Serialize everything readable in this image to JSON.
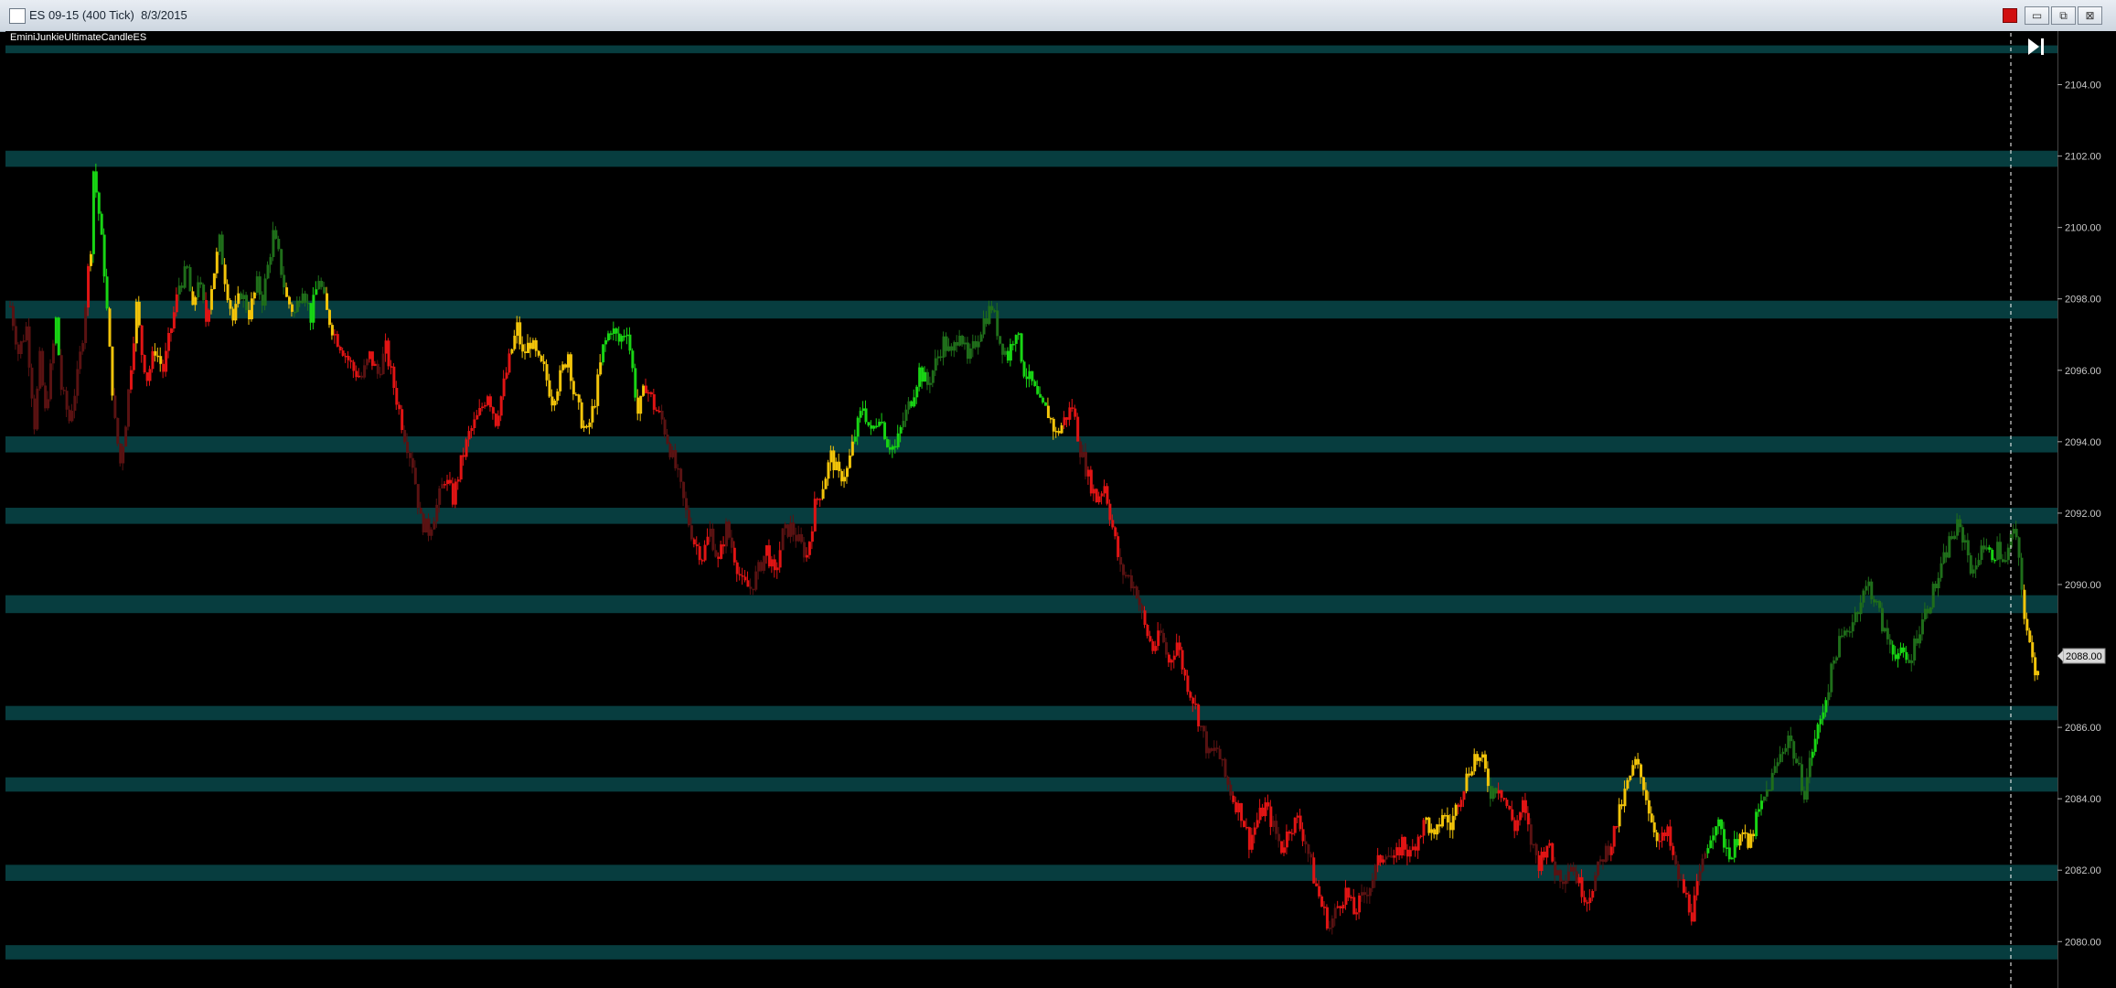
{
  "window": {
    "title": "ES 09-15 (400 Tick)  8/3/2015",
    "buttons": {
      "minimize": "▭",
      "restore": "⧉",
      "close": "⊠"
    }
  },
  "indicator_label": "EminiJunkieUltimateCandleES",
  "colors": {
    "background": "#000000",
    "zone": "#073d3f",
    "bull_strong": "#18d414",
    "bull_weak": "#1f6e1a",
    "bear_strong": "#e01414",
    "bear_weak": "#5a1212",
    "neutral": "#f2c40a",
    "axis_text": "#c8c8c8",
    "price_marker_bg": "#d8d8d8"
  },
  "chart_data": {
    "type": "candlestick",
    "symbol": "ES 09-15",
    "interval": "400 Tick",
    "ylim": [
      2078.7,
      2105.5
    ],
    "yticks": [
      "2080.00",
      "2082.00",
      "2084.00",
      "2086.00",
      "2088.00",
      "2090.00",
      "2092.00",
      "2094.00",
      "2096.00",
      "2098.00",
      "2100.00",
      "2102.00",
      "2104.00"
    ],
    "last_price": "2088.00",
    "zones": [
      [
        2104.88,
        2105.1
      ],
      [
        2101.7,
        2102.15
      ],
      [
        2097.45,
        2097.95
      ],
      [
        2093.7,
        2094.15
      ],
      [
        2091.7,
        2092.15
      ],
      [
        2089.2,
        2089.7
      ],
      [
        2086.2,
        2086.6
      ],
      [
        2084.2,
        2084.6
      ],
      [
        2081.7,
        2082.15
      ],
      [
        2079.5,
        2079.9
      ]
    ],
    "price_path": [
      [
        0,
        2097.8,
        "bw"
      ],
      [
        6,
        2096.5,
        "bw"
      ],
      [
        12,
        2097.2,
        "bw"
      ],
      [
        18,
        2094.5,
        "bw"
      ],
      [
        22,
        2096.3,
        "bw"
      ],
      [
        26,
        2094.8,
        "bw"
      ],
      [
        30,
        2096.0,
        "bw"
      ],
      [
        34,
        2097.4,
        "g"
      ],
      [
        38,
        2095.5,
        "bw"
      ],
      [
        44,
        2094.6,
        "bw"
      ],
      [
        50,
        2095.8,
        "bw"
      ],
      [
        54,
        2097.0,
        "bw"
      ],
      [
        58,
        2098.8,
        "r"
      ],
      [
        60,
        2099.5,
        "y"
      ],
      [
        62,
        2101.6,
        "g"
      ],
      [
        66,
        2100.4,
        "g"
      ],
      [
        70,
        2098.8,
        "g"
      ],
      [
        74,
        2096.5,
        "y"
      ],
      [
        78,
        2094.5,
        "bw"
      ],
      [
        82,
        2093.4,
        "bw"
      ],
      [
        86,
        2094.6,
        "bw"
      ],
      [
        90,
        2096.2,
        "r"
      ],
      [
        94,
        2097.8,
        "y"
      ],
      [
        98,
        2096.5,
        "r"
      ],
      [
        102,
        2095.8,
        "r"
      ],
      [
        108,
        2096.6,
        "y"
      ],
      [
        114,
        2096.0,
        "r"
      ],
      [
        120,
        2097.2,
        "r"
      ],
      [
        126,
        2098.4,
        "gw"
      ],
      [
        132,
        2098.8,
        "gw"
      ],
      [
        136,
        2097.6,
        "y"
      ],
      [
        140,
        2098.6,
        "gw"
      ],
      [
        146,
        2097.4,
        "r"
      ],
      [
        150,
        2098.4,
        "y"
      ],
      [
        156,
        2099.6,
        "gw"
      ],
      [
        160,
        2098.6,
        "y"
      ],
      [
        166,
        2097.4,
        "y"
      ],
      [
        172,
        2098.2,
        "gw"
      ],
      [
        178,
        2097.6,
        "y"
      ],
      [
        184,
        2098.4,
        "gw"
      ],
      [
        188,
        2098.0,
        "gw"
      ],
      [
        196,
        2099.8,
        "gw"
      ],
      [
        200,
        2099.2,
        "gw"
      ],
      [
        206,
        2098.0,
        "y"
      ],
      [
        212,
        2097.6,
        "gw"
      ],
      [
        218,
        2098.4,
        "gw"
      ],
      [
        224,
        2097.5,
        "g"
      ],
      [
        230,
        2098.6,
        "gw"
      ],
      [
        236,
        2097.6,
        "y"
      ],
      [
        242,
        2097.0,
        "r"
      ],
      [
        248,
        2096.6,
        "r"
      ],
      [
        256,
        2096.0,
        "r"
      ],
      [
        262,
        2095.8,
        "bw"
      ],
      [
        268,
        2096.4,
        "r"
      ],
      [
        274,
        2095.9,
        "bw"
      ],
      [
        280,
        2096.6,
        "r"
      ],
      [
        288,
        2095.2,
        "r"
      ],
      [
        294,
        2094.2,
        "bw"
      ],
      [
        300,
        2093.4,
        "bw"
      ],
      [
        306,
        2091.8,
        "bw"
      ],
      [
        312,
        2091.5,
        "bw"
      ],
      [
        318,
        2092.2,
        "bw"
      ],
      [
        324,
        2093.0,
        "r"
      ],
      [
        330,
        2092.4,
        "r"
      ],
      [
        336,
        2093.4,
        "r"
      ],
      [
        342,
        2094.2,
        "r"
      ],
      [
        350,
        2094.8,
        "r"
      ],
      [
        356,
        2095.4,
        "r"
      ],
      [
        362,
        2094.6,
        "r"
      ],
      [
        368,
        2095.6,
        "r"
      ],
      [
        374,
        2096.6,
        "y"
      ],
      [
        378,
        2097.2,
        "y"
      ],
      [
        382,
        2096.4,
        "y"
      ],
      [
        388,
        2096.8,
        "y"
      ],
      [
        394,
        2096.2,
        "y"
      ],
      [
        398,
        2096.0,
        "y"
      ],
      [
        404,
        2095.2,
        "y"
      ],
      [
        410,
        2095.8,
        "y"
      ],
      [
        416,
        2096.5,
        "y"
      ],
      [
        420,
        2095.4,
        "y"
      ],
      [
        426,
        2094.6,
        "y"
      ],
      [
        430,
        2094.2,
        "y"
      ],
      [
        436,
        2095.2,
        "y"
      ],
      [
        442,
        2096.6,
        "g"
      ],
      [
        448,
        2097.2,
        "g"
      ],
      [
        454,
        2096.8,
        "g"
      ],
      [
        460,
        2097.2,
        "g"
      ],
      [
        464,
        2096.0,
        "g"
      ],
      [
        468,
        2094.8,
        "y"
      ],
      [
        474,
        2095.6,
        "r"
      ],
      [
        480,
        2095.0,
        "r"
      ],
      [
        486,
        2094.6,
        "bw"
      ],
      [
        492,
        2093.8,
        "bw"
      ],
      [
        498,
        2093.0,
        "bw"
      ],
      [
        504,
        2092.0,
        "bw"
      ],
      [
        510,
        2091.2,
        "r"
      ],
      [
        516,
        2090.8,
        "r"
      ],
      [
        522,
        2091.5,
        "bw"
      ],
      [
        528,
        2090.6,
        "r"
      ],
      [
        534,
        2091.6,
        "bw"
      ],
      [
        540,
        2090.8,
        "r"
      ],
      [
        546,
        2090.0,
        "r"
      ],
      [
        552,
        2089.9,
        "bw"
      ],
      [
        558,
        2090.4,
        "bw"
      ],
      [
        564,
        2091.0,
        "r"
      ],
      [
        570,
        2090.2,
        "r"
      ],
      [
        576,
        2091.4,
        "bw"
      ],
      [
        582,
        2091.6,
        "bw"
      ],
      [
        588,
        2091.2,
        "bw"
      ],
      [
        594,
        2090.8,
        "r"
      ],
      [
        600,
        2092.2,
        "r"
      ],
      [
        606,
        2092.8,
        "y"
      ],
      [
        612,
        2093.6,
        "y"
      ],
      [
        618,
        2093.0,
        "y"
      ],
      [
        624,
        2093.2,
        "y"
      ],
      [
        630,
        2094.2,
        "g"
      ],
      [
        636,
        2095.0,
        "g"
      ],
      [
        642,
        2094.2,
        "g"
      ],
      [
        648,
        2094.8,
        "g"
      ],
      [
        654,
        2094.0,
        "g"
      ],
      [
        660,
        2093.8,
        "g"
      ],
      [
        666,
        2094.6,
        "gw"
      ],
      [
        672,
        2095.2,
        "g"
      ],
      [
        678,
        2096.0,
        "g"
      ],
      [
        684,
        2095.6,
        "gw"
      ],
      [
        690,
        2096.2,
        "gw"
      ],
      [
        696,
        2096.8,
        "gw"
      ],
      [
        702,
        2096.4,
        "gw"
      ],
      [
        708,
        2097.2,
        "gw"
      ],
      [
        714,
        2096.2,
        "gw"
      ],
      [
        720,
        2096.8,
        "gw"
      ],
      [
        726,
        2097.4,
        "gw"
      ],
      [
        732,
        2097.8,
        "gw"
      ],
      [
        738,
        2096.8,
        "gw"
      ],
      [
        744,
        2096.4,
        "g"
      ],
      [
        750,
        2097.2,
        "g"
      ],
      [
        756,
        2096.0,
        "g"
      ],
      [
        762,
        2095.6,
        "g"
      ],
      [
        768,
        2095.0,
        "g"
      ],
      [
        774,
        2094.8,
        "y"
      ],
      [
        780,
        2094.2,
        "y"
      ],
      [
        786,
        2094.6,
        "r"
      ],
      [
        792,
        2095.0,
        "r"
      ],
      [
        798,
        2093.8,
        "bw"
      ],
      [
        804,
        2093.0,
        "r"
      ],
      [
        810,
        2092.4,
        "r"
      ],
      [
        816,
        2092.8,
        "r"
      ],
      [
        822,
        2091.6,
        "r"
      ],
      [
        828,
        2090.4,
        "bw"
      ],
      [
        834,
        2090.2,
        "bw"
      ],
      [
        840,
        2089.8,
        "bw"
      ],
      [
        846,
        2088.8,
        "r"
      ],
      [
        852,
        2088.2,
        "r"
      ],
      [
        858,
        2088.6,
        "bw"
      ],
      [
        864,
        2087.8,
        "r"
      ],
      [
        870,
        2088.4,
        "r"
      ],
      [
        876,
        2087.4,
        "r"
      ],
      [
        882,
        2086.8,
        "r"
      ],
      [
        888,
        2086.0,
        "bw"
      ],
      [
        894,
        2085.2,
        "bw"
      ],
      [
        900,
        2085.4,
        "bw"
      ],
      [
        906,
        2084.6,
        "bw"
      ],
      [
        912,
        2084.0,
        "r"
      ],
      [
        918,
        2083.6,
        "r"
      ],
      [
        924,
        2082.8,
        "r"
      ],
      [
        930,
        2083.4,
        "r"
      ],
      [
        936,
        2083.8,
        "r"
      ],
      [
        942,
        2083.2,
        "bw"
      ],
      [
        948,
        2082.6,
        "r"
      ],
      [
        954,
        2083.2,
        "r"
      ],
      [
        960,
        2083.4,
        "r"
      ],
      [
        966,
        2082.8,
        "bw"
      ],
      [
        972,
        2081.8,
        "r"
      ],
      [
        978,
        2081.0,
        "r"
      ],
      [
        984,
        2080.4,
        "bw"
      ],
      [
        990,
        2081.0,
        "r"
      ],
      [
        996,
        2081.4,
        "r"
      ],
      [
        1002,
        2080.8,
        "r"
      ],
      [
        1008,
        2081.2,
        "bw"
      ],
      [
        1014,
        2081.6,
        "bw"
      ],
      [
        1020,
        2082.2,
        "r"
      ],
      [
        1026,
        2082.6,
        "bw"
      ],
      [
        1032,
        2082.2,
        "r"
      ],
      [
        1038,
        2082.8,
        "r"
      ],
      [
        1044,
        2082.4,
        "r"
      ],
      [
        1050,
        2083.0,
        "r"
      ],
      [
        1056,
        2083.4,
        "y"
      ],
      [
        1062,
        2082.8,
        "y"
      ],
      [
        1068,
        2083.6,
        "y"
      ],
      [
        1074,
        2083.2,
        "y"
      ],
      [
        1080,
        2084.0,
        "r"
      ],
      [
        1086,
        2084.6,
        "y"
      ],
      [
        1092,
        2085.2,
        "y"
      ],
      [
        1098,
        2085.0,
        "y"
      ],
      [
        1104,
        2084.2,
        "gw"
      ],
      [
        1110,
        2084.4,
        "r"
      ],
      [
        1116,
        2083.8,
        "r"
      ],
      [
        1122,
        2083.2,
        "r"
      ],
      [
        1128,
        2083.8,
        "r"
      ],
      [
        1134,
        2082.8,
        "bw"
      ],
      [
        1140,
        2082.2,
        "r"
      ],
      [
        1146,
        2082.8,
        "r"
      ],
      [
        1152,
        2082.0,
        "bw"
      ],
      [
        1158,
        2081.8,
        "bw"
      ],
      [
        1164,
        2082.2,
        "bw"
      ],
      [
        1170,
        2081.6,
        "r"
      ],
      [
        1176,
        2081.2,
        "r"
      ],
      [
        1182,
        2081.8,
        "bw"
      ],
      [
        1188,
        2082.4,
        "bw"
      ],
      [
        1194,
        2082.8,
        "r"
      ],
      [
        1200,
        2083.6,
        "y"
      ],
      [
        1206,
        2084.4,
        "y"
      ],
      [
        1212,
        2085.0,
        "y"
      ],
      [
        1218,
        2084.4,
        "y"
      ],
      [
        1224,
        2083.4,
        "y"
      ],
      [
        1230,
        2082.8,
        "r"
      ],
      [
        1236,
        2083.0,
        "r"
      ],
      [
        1242,
        2082.0,
        "bw"
      ],
      [
        1248,
        2081.4,
        "r"
      ],
      [
        1254,
        2080.8,
        "r"
      ],
      [
        1260,
        2081.8,
        "bw"
      ],
      [
        1266,
        2082.8,
        "g"
      ],
      [
        1272,
        2083.4,
        "g"
      ],
      [
        1278,
        2082.8,
        "g"
      ],
      [
        1284,
        2082.4,
        "g"
      ],
      [
        1290,
        2083.2,
        "y"
      ],
      [
        1296,
        2082.6,
        "y"
      ],
      [
        1302,
        2083.4,
        "g"
      ],
      [
        1308,
        2084.0,
        "gw"
      ],
      [
        1314,
        2084.6,
        "gw"
      ],
      [
        1320,
        2085.2,
        "gw"
      ],
      [
        1326,
        2085.8,
        "gw"
      ],
      [
        1332,
        2085.0,
        "gw"
      ],
      [
        1338,
        2084.2,
        "gw"
      ],
      [
        1344,
        2085.4,
        "g"
      ],
      [
        1350,
        2086.2,
        "g"
      ],
      [
        1356,
        2087.2,
        "gw"
      ],
      [
        1362,
        2088.2,
        "gw"
      ],
      [
        1368,
        2088.6,
        "gw"
      ],
      [
        1374,
        2089.0,
        "gw"
      ],
      [
        1380,
        2089.6,
        "gw"
      ],
      [
        1386,
        2090.0,
        "gw"
      ],
      [
        1392,
        2089.4,
        "gw"
      ],
      [
        1398,
        2088.6,
        "gw"
      ],
      [
        1404,
        2088.2,
        "g"
      ],
      [
        1410,
        2088.0,
        "g"
      ],
      [
        1416,
        2087.8,
        "gw"
      ],
      [
        1422,
        2088.6,
        "gw"
      ],
      [
        1428,
        2089.2,
        "gw"
      ],
      [
        1434,
        2089.8,
        "gw"
      ],
      [
        1440,
        2090.4,
        "gw"
      ],
      [
        1446,
        2091.2,
        "gw"
      ],
      [
        1452,
        2091.6,
        "gw"
      ],
      [
        1458,
        2091.2,
        "gw"
      ],
      [
        1464,
        2090.2,
        "gw"
      ],
      [
        1470,
        2091.2,
        "gw"
      ],
      [
        1476,
        2090.8,
        "g"
      ],
      [
        1482,
        2091.0,
        "gw"
      ],
      [
        1488,
        2090.6,
        "gw"
      ],
      [
        1494,
        2091.6,
        "gw"
      ],
      [
        1498,
        2090.6,
        "gw"
      ],
      [
        1502,
        2089.2,
        "y"
      ],
      [
        1506,
        2088.2,
        "y"
      ],
      [
        1510,
        2087.6,
        "y"
      ],
      [
        1514,
        2088.0,
        "r"
      ]
    ]
  }
}
